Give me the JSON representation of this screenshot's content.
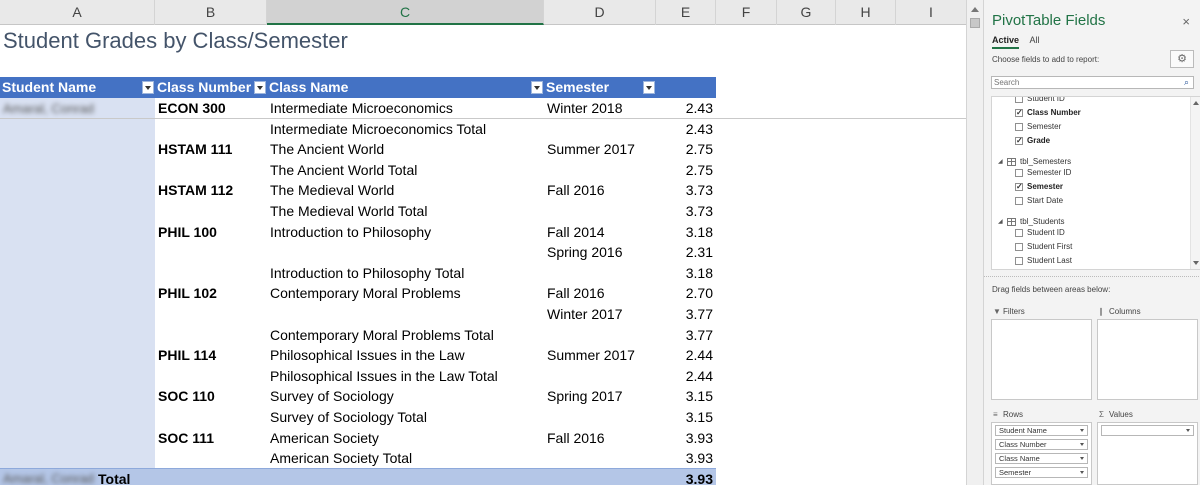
{
  "columns": [
    "A",
    "B",
    "C",
    "D",
    "E",
    "F",
    "G",
    "H",
    "I"
  ],
  "selected_column": "C",
  "report_title": "Student Grades by Class/Semester",
  "header_row": {
    "student_name": "Student Name",
    "class_number": "Class Number",
    "class_name": "Class Name",
    "semester": "Semester"
  },
  "student_name_blurred": "Amaral, Conrad",
  "rows": [
    {
      "class_number": "ECON 300",
      "class_name": "Intermediate Microeconomics",
      "semester": "Winter 2018",
      "grade": "2.43"
    },
    {
      "class_number": "",
      "class_name": "Intermediate Microeconomics Total",
      "semester": "",
      "grade": "2.43"
    },
    {
      "class_number": "HSTAM 111",
      "class_name": "The Ancient World",
      "semester": "Summer 2017",
      "grade": "2.75"
    },
    {
      "class_number": "",
      "class_name": "The Ancient World Total",
      "semester": "",
      "grade": "2.75"
    },
    {
      "class_number": "HSTAM 112",
      "class_name": "The Medieval World",
      "semester": "Fall 2016",
      "grade": "3.73"
    },
    {
      "class_number": "",
      "class_name": "The Medieval World Total",
      "semester": "",
      "grade": "3.73"
    },
    {
      "class_number": "PHIL 100",
      "class_name": "Introduction to Philosophy",
      "semester": "Fall 2014",
      "grade": "3.18"
    },
    {
      "class_number": "",
      "class_name": "",
      "semester": "Spring 2016",
      "grade": "2.31"
    },
    {
      "class_number": "",
      "class_name": "Introduction to Philosophy Total",
      "semester": "",
      "grade": "3.18"
    },
    {
      "class_number": "PHIL 102",
      "class_name": "Contemporary Moral Problems",
      "semester": "Fall 2016",
      "grade": "2.70"
    },
    {
      "class_number": "",
      "class_name": "",
      "semester": "Winter 2017",
      "grade": "3.77"
    },
    {
      "class_number": "",
      "class_name": "Contemporary Moral Problems Total",
      "semester": "",
      "grade": "3.77"
    },
    {
      "class_number": "PHIL 114",
      "class_name": "Philosophical Issues in the Law",
      "semester": "Summer 2017",
      "grade": "2.44"
    },
    {
      "class_number": "",
      "class_name": "Philosophical Issues in the Law Total",
      "semester": "",
      "grade": "2.44"
    },
    {
      "class_number": "SOC 110",
      "class_name": "Survey of Sociology",
      "semester": "Spring 2017",
      "grade": "3.15"
    },
    {
      "class_number": "",
      "class_name": "Survey of Sociology Total",
      "semester": "",
      "grade": "3.15"
    },
    {
      "class_number": "SOC 111",
      "class_name": "American Society",
      "semester": "Fall 2016",
      "grade": "3.93"
    },
    {
      "class_number": "",
      "class_name": "American Society Total",
      "semester": "",
      "grade": "3.93"
    }
  ],
  "total_row": {
    "label": "Total",
    "value": "3.93"
  },
  "pivot": {
    "title": "PivotTable Fields",
    "close": "×",
    "tabs": [
      "Active",
      "All"
    ],
    "choose_label": "Choose fields to add to report:",
    "gear": "⚙",
    "search_placeholder": "Search",
    "fields": [
      {
        "kind": "field",
        "label": "Student ID",
        "checked": false,
        "bold": false
      },
      {
        "kind": "field",
        "label": "Class Number",
        "checked": true,
        "bold": true
      },
      {
        "kind": "field",
        "label": "Semester",
        "checked": false,
        "bold": false
      },
      {
        "kind": "field",
        "label": "Grade",
        "checked": true,
        "bold": true
      },
      {
        "kind": "table",
        "label": "tbl_Semesters"
      },
      {
        "kind": "field",
        "label": "Semester ID",
        "checked": false,
        "bold": false
      },
      {
        "kind": "field",
        "label": "Semester",
        "checked": true,
        "bold": true
      },
      {
        "kind": "field",
        "label": "Start Date",
        "checked": false,
        "bold": false
      },
      {
        "kind": "table",
        "label": "tbl_Students"
      },
      {
        "kind": "field",
        "label": "Student ID",
        "checked": false,
        "bold": false
      },
      {
        "kind": "field",
        "label": "Student First",
        "checked": false,
        "bold": false
      },
      {
        "kind": "field",
        "label": "Student Last",
        "checked": false,
        "bold": false
      }
    ],
    "drag_label": "Drag fields between areas below:",
    "areas": {
      "filters": "Filters",
      "columns": "Columns",
      "rows": "Rows",
      "values": "Values"
    },
    "row_fields": [
      "Student Name",
      "Class Number",
      "Class Name",
      "Semester"
    ]
  }
}
